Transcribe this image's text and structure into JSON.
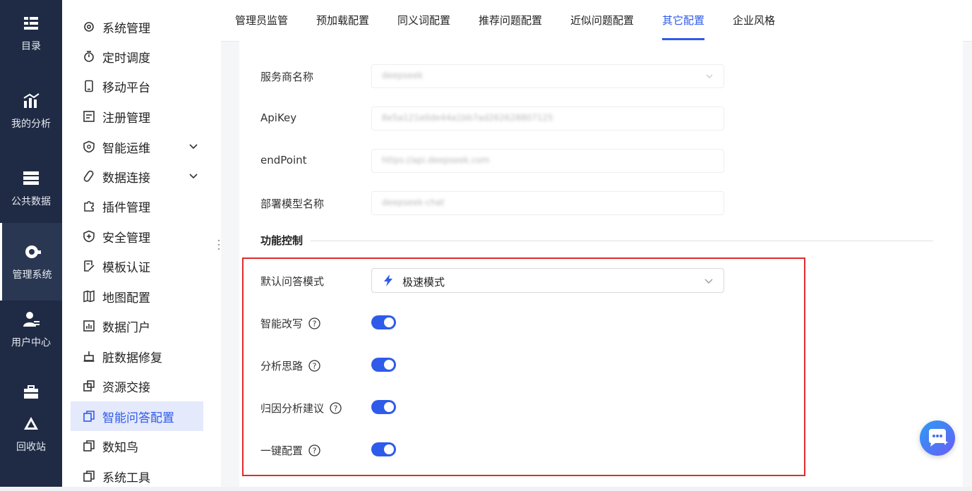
{
  "rail": [
    {
      "label": "目录",
      "icon": "catalog-icon"
    },
    {
      "label": "我的分析",
      "icon": "analysis-icon"
    },
    {
      "label": "公共数据",
      "icon": "public-data-icon"
    },
    {
      "label": "管理系统",
      "icon": "management-icon",
      "active": true
    },
    {
      "label": "用户中心",
      "icon": "user-center-icon"
    },
    {
      "label": "回收站",
      "icon": "recycle-bin-icon"
    }
  ],
  "menu": [
    {
      "label": "系统管理",
      "icon": "gear-icon"
    },
    {
      "label": "定时调度",
      "icon": "timer-icon"
    },
    {
      "label": "移动平台",
      "icon": "mobile-icon"
    },
    {
      "label": "注册管理",
      "icon": "register-icon"
    },
    {
      "label": "智能运维",
      "icon": "ops-icon",
      "expandable": true
    },
    {
      "label": "数据连接",
      "icon": "link-icon",
      "expandable": true
    },
    {
      "label": "插件管理",
      "icon": "plugin-icon"
    },
    {
      "label": "安全管理",
      "icon": "shield-icon"
    },
    {
      "label": "模板认证",
      "icon": "template-icon"
    },
    {
      "label": "地图配置",
      "icon": "map-icon"
    },
    {
      "label": "数据门户",
      "icon": "portal-icon"
    },
    {
      "label": "脏数据修复",
      "icon": "repair-icon"
    },
    {
      "label": "资源交接",
      "icon": "handover-icon"
    },
    {
      "label": "智能问答配置",
      "icon": "copy-icon",
      "active": true
    },
    {
      "label": "数知鸟",
      "icon": "copy-icon"
    },
    {
      "label": "系统工具",
      "icon": "copy-icon"
    }
  ],
  "tabs": [
    "管理员监管",
    "预加载配置",
    "同义词配置",
    "推荐问题配置",
    "近似问题配置",
    "其它配置",
    "企业风格"
  ],
  "active_tab": "其它配置",
  "form": {
    "provider_label": "服务商名称",
    "provider_value": "deepseek",
    "apikey_label": "ApiKey",
    "apikey_value": "8e5a121e0de44a1bb7ad262628807125",
    "endpoint_label": "endPoint",
    "endpoint_value": "https://api.deepseek.com",
    "model_label": "部署模型名称",
    "model_value": "deepseek-chat"
  },
  "section_title": "功能控制",
  "controls": {
    "mode_label": "默认问答模式",
    "mode_value": "极速模式",
    "toggles": [
      {
        "label": "智能改写",
        "on": true
      },
      {
        "label": "分析思路",
        "on": true
      },
      {
        "label": "归因分析建议",
        "on": true
      },
      {
        "label": "一键配置",
        "on": true
      }
    ]
  },
  "colors": {
    "accent": "#2f5bea",
    "rail_bg": "#1f2b45",
    "highlight_border": "#e02b2b"
  }
}
